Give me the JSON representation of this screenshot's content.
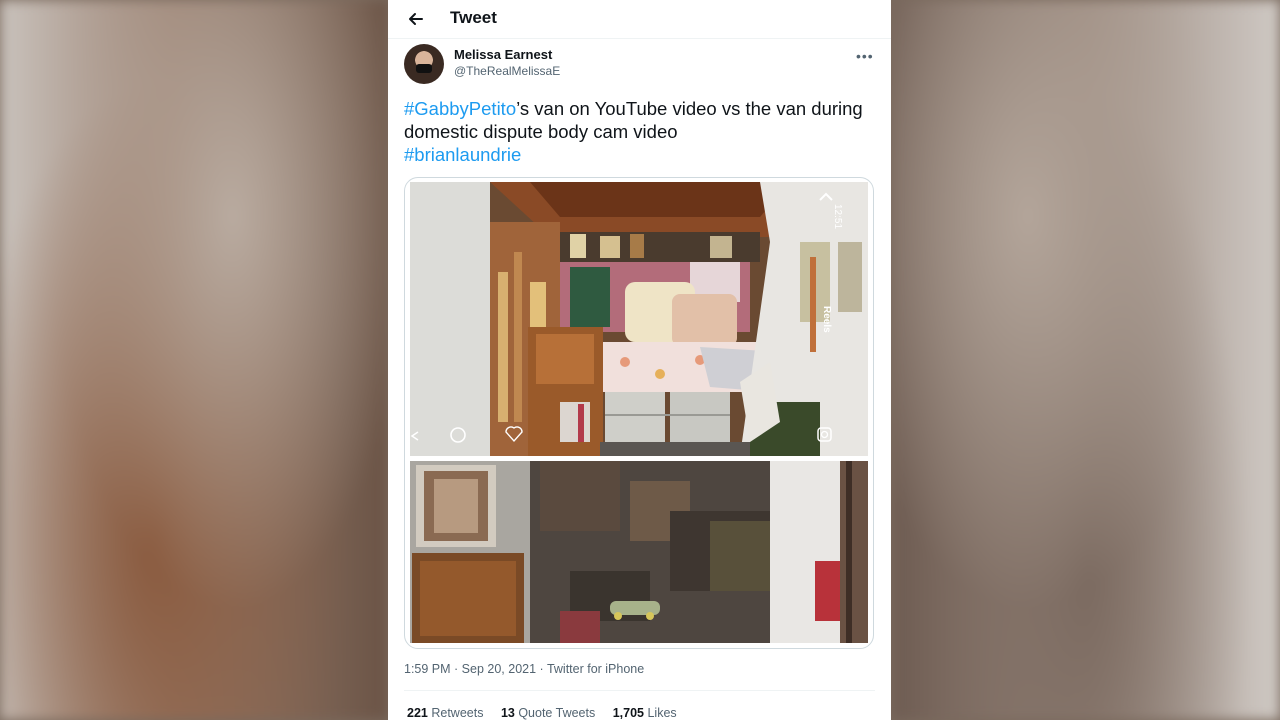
{
  "header": {
    "title": "Tweet",
    "back_icon": "arrow-left-icon"
  },
  "author": {
    "display_name": "Melissa Earnest",
    "handle": "@TheRealMelissaE"
  },
  "tweet": {
    "hashtag_1": "#GabbyPetito",
    "text_1": "’s van on YouTube video vs the van during domestic dispute body cam video",
    "hashtag_2": "#brianlaundrie"
  },
  "media": {
    "top_overlay": {
      "time": "12:51",
      "reels_label": "Reels"
    }
  },
  "meta": {
    "time": "1:59 PM",
    "date": "Sep 20, 2021",
    "source": "Twitter for iPhone",
    "separator": " · "
  },
  "stats": {
    "retweets_count": "221",
    "retweets_label": "Retweets",
    "quotes_count": "13",
    "quotes_label": "Quote Tweets",
    "likes_count": "1,705",
    "likes_label": "Likes"
  },
  "colors": {
    "link": "#1d9bf0",
    "text": "#0f1419",
    "muted": "#536471"
  }
}
